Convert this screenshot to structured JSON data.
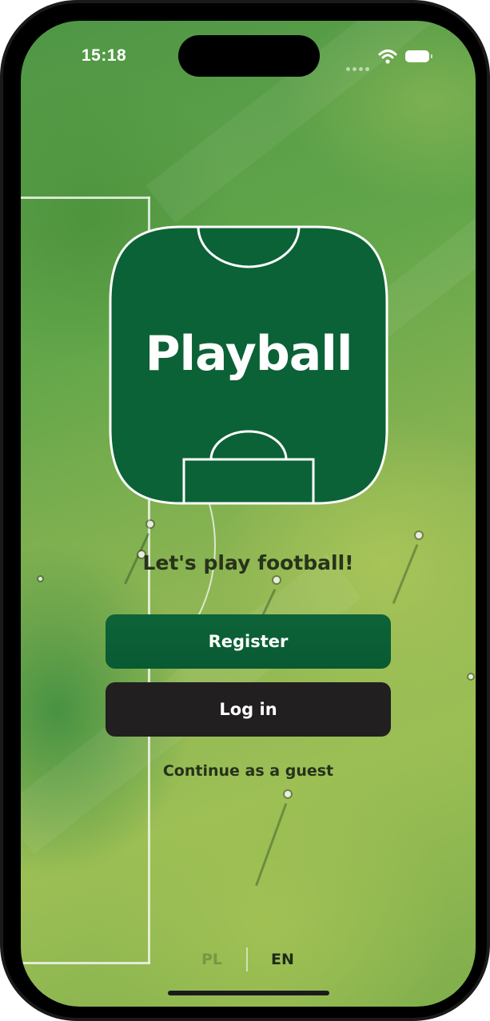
{
  "status_bar": {
    "time": "15:18",
    "icons": [
      "cellular-dots-icon",
      "wifi-icon",
      "battery-icon"
    ]
  },
  "logo": {
    "text": "Playball",
    "colors": {
      "fill": "#0b6236",
      "outline": "#ffffff"
    }
  },
  "welcome": {
    "tagline": "Let's play football!"
  },
  "actions": {
    "register_label": "Register",
    "login_label": "Log in",
    "guest_label": "Continue as a guest"
  },
  "language": {
    "options": [
      "PL",
      "EN"
    ],
    "selected": "EN"
  },
  "colors": {
    "register_button": "#0b6236",
    "login_button": "#221f20",
    "pitch_green": "#6aa84a"
  }
}
